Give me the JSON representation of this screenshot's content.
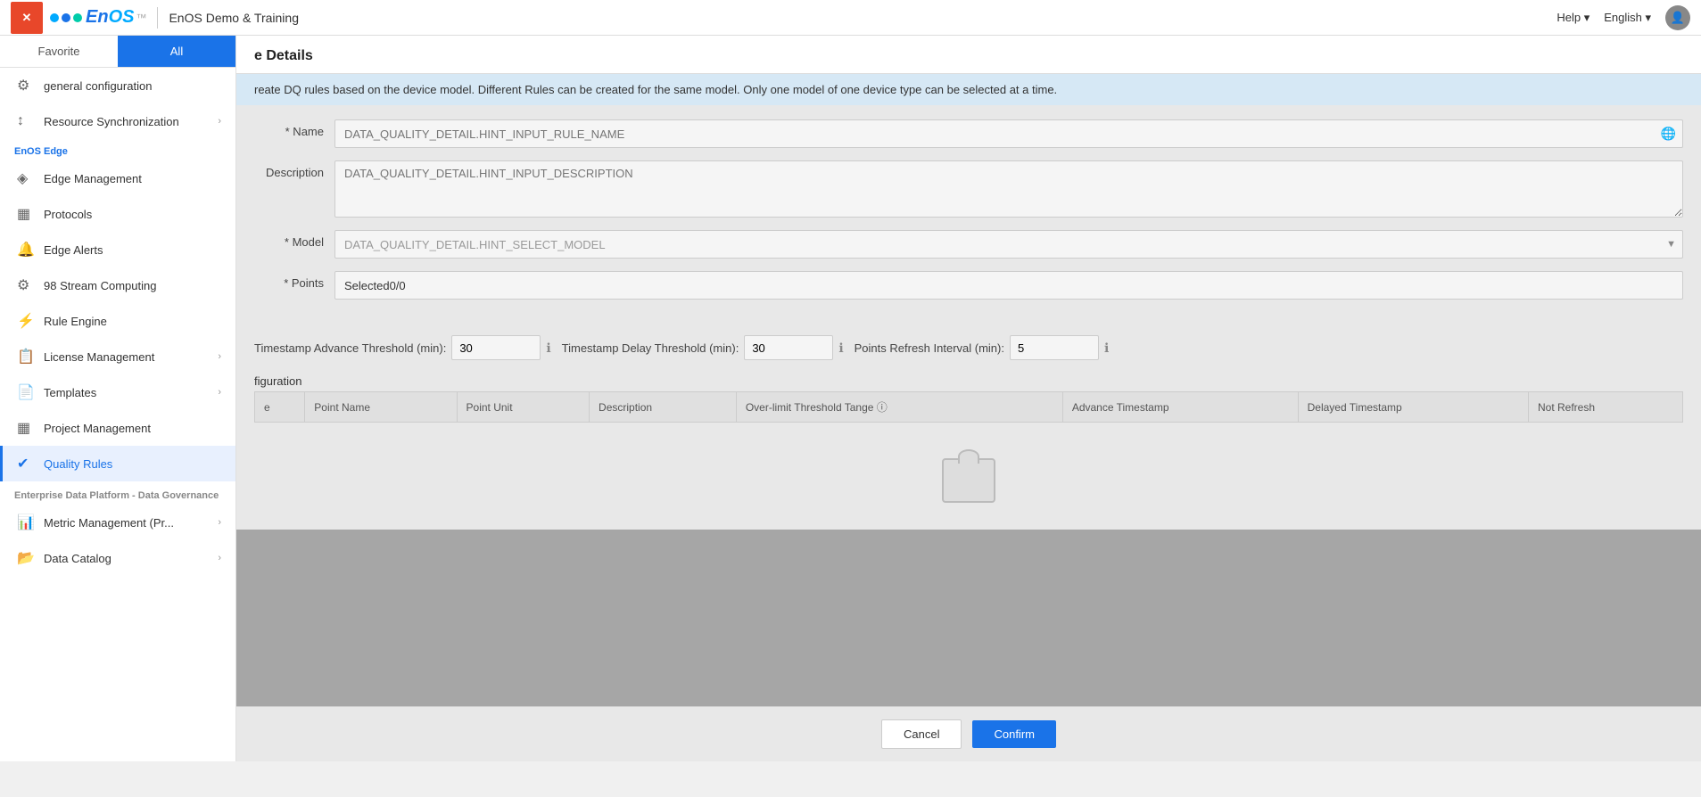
{
  "header": {
    "close_label": "✕",
    "logo_text_en": "En",
    "logo_text_os": "OS",
    "app_name": "EnOS Demo & Training",
    "help_label": "Help ▾",
    "english_label": "English ▾"
  },
  "sidebar": {
    "tab_favorite": "Favorite",
    "tab_all": "All",
    "items": [
      {
        "id": "general-config",
        "label": "general configuration",
        "icon": "⚙"
      },
      {
        "id": "resource-sync",
        "label": "Resource Synchronization",
        "icon": "↕",
        "arrow": "›"
      }
    ],
    "enos_edge_label": "EnOS Edge",
    "edge_items": [
      {
        "id": "edge-management",
        "label": "Edge Management",
        "icon": "◈"
      },
      {
        "id": "protocols",
        "label": "Protocols",
        "icon": "▦"
      },
      {
        "id": "edge-alerts",
        "label": "Edge Alerts",
        "icon": "🔔"
      },
      {
        "id": "stream-computing",
        "label": "98   Stream Computing",
        "icon": "⚙"
      },
      {
        "id": "rule-engine",
        "label": "Rule Engine",
        "icon": "⚡"
      },
      {
        "id": "license-management",
        "label": "License Management",
        "icon": "📋",
        "arrow": "›"
      },
      {
        "id": "templates",
        "label": "Templates",
        "icon": "📄",
        "arrow": "›"
      },
      {
        "id": "project-management",
        "label": "Project Management",
        "icon": "▦"
      },
      {
        "id": "quality-rules",
        "label": "Quality Rules",
        "icon": "✔",
        "active": true
      }
    ],
    "enterprise_label": "Enterprise Data Platform - Data Governance",
    "enterprise_items": [
      {
        "id": "metric-management",
        "label": "Metric Management (Pr...",
        "icon": "📊",
        "arrow": "›"
      },
      {
        "id": "data-catalog",
        "label": "Data Catalog",
        "icon": "📂",
        "arrow": "›"
      }
    ]
  },
  "panel": {
    "title": "e Details",
    "info_text": "reate DQ rules based on the device model. Different Rules can be created for the same model. Only one model of one device type can be selected at a time.",
    "form": {
      "name_label": "* Name",
      "name_placeholder": "DATA_QUALITY_DETAIL.HINT_INPUT_RULE_NAME",
      "description_label": "Description",
      "description_placeholder": "DATA_QUALITY_DETAIL.HINT_INPUT_DESCRIPTION",
      "model_label": "* Model",
      "model_placeholder": "DATA_QUALITY_DETAIL.HINT_SELECT_MODEL",
      "points_label": "* Points",
      "points_value": "Selected0/0"
    },
    "threshold": {
      "advance_label": "Timestamp Advance Threshold (min):",
      "advance_value": "30",
      "delay_label": "Timestamp Delay Threshold (min):",
      "delay_value": "30",
      "refresh_label": "Points Refresh Interval (min):",
      "refresh_value": "5"
    },
    "config_label": "figuration",
    "table": {
      "columns": [
        "e",
        "Point Name",
        "Point Unit",
        "Description",
        "Over-limit Threshold Tange ⓘ",
        "Advance Timestamp",
        "Delayed Timestamp",
        "Not Refresh"
      ]
    },
    "footer": {
      "cancel_label": "Cancel",
      "confirm_label": "Confirm"
    }
  }
}
